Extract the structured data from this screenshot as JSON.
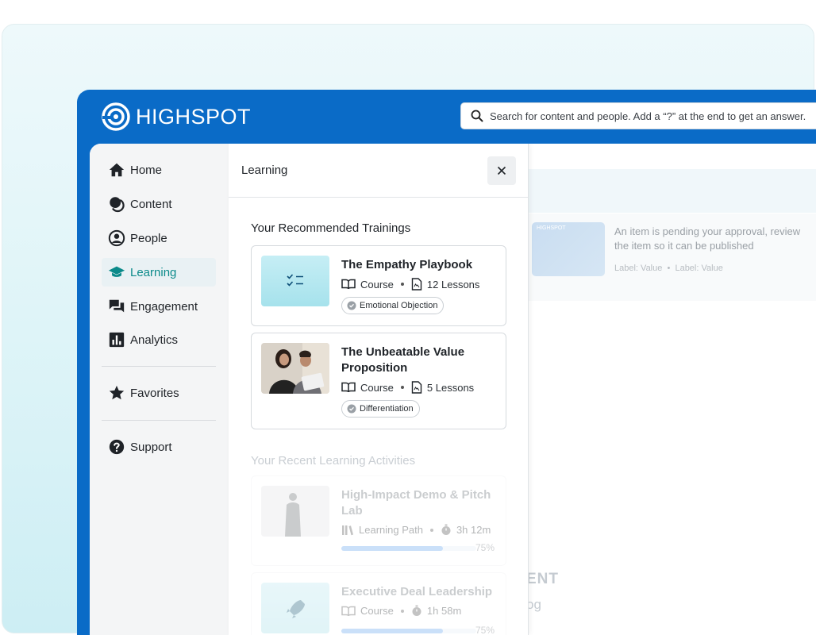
{
  "app": {
    "brand": "HIGHSPOT",
    "search_placeholder": "Search for content and people. Add a “?” at the end to get an answer."
  },
  "sidebar": {
    "items": [
      {
        "label": "Home",
        "icon": "home-icon"
      },
      {
        "label": "Content",
        "icon": "content-icon"
      },
      {
        "label": "People",
        "icon": "person-icon"
      },
      {
        "label": "Learning",
        "icon": "graduation-cap-icon",
        "active": true
      },
      {
        "label": "Engagement",
        "icon": "chat-icon"
      },
      {
        "label": "Analytics",
        "icon": "chart-icon"
      },
      {
        "label": "Favorites",
        "icon": "star-icon"
      },
      {
        "label": "Support",
        "icon": "help-icon"
      }
    ]
  },
  "panel": {
    "title": "Learning",
    "recommended_title": "Your Recommended Trainings",
    "recommended": [
      {
        "title": "The Empathy Playbook",
        "type": "Course",
        "lessons": "12 Lessons",
        "tag": "Emotional Objection"
      },
      {
        "title": "The Unbeatable Value Proposition",
        "type": "Course",
        "lessons": "5 Lessons",
        "tag": "Differentiation"
      }
    ],
    "recent_title": "Your Recent Learning Activities",
    "recent": [
      {
        "title": "High-Impact Demo & Pitch Lab",
        "type": "Learning Path",
        "duration": "3h 12m",
        "progress": 75,
        "progress_label": "75%"
      },
      {
        "title": "Executive Deal Leadership",
        "type": "Course",
        "duration": "1h 58m",
        "progress": 75,
        "progress_label": "75%"
      }
    ]
  },
  "background": {
    "approval_note": "An item is pending your approval, review the item so it can be published",
    "meta_label_1": "Label:",
    "meta_value_1": "Value",
    "meta_label_2": "Label:",
    "meta_value_2": "Value",
    "thumb_brand": "HIGHSPOT",
    "big_text": "ENT",
    "small_text": "og"
  },
  "colors": {
    "brand_blue": "#0a6bc7",
    "accent_teal": "#0b8a8a"
  }
}
